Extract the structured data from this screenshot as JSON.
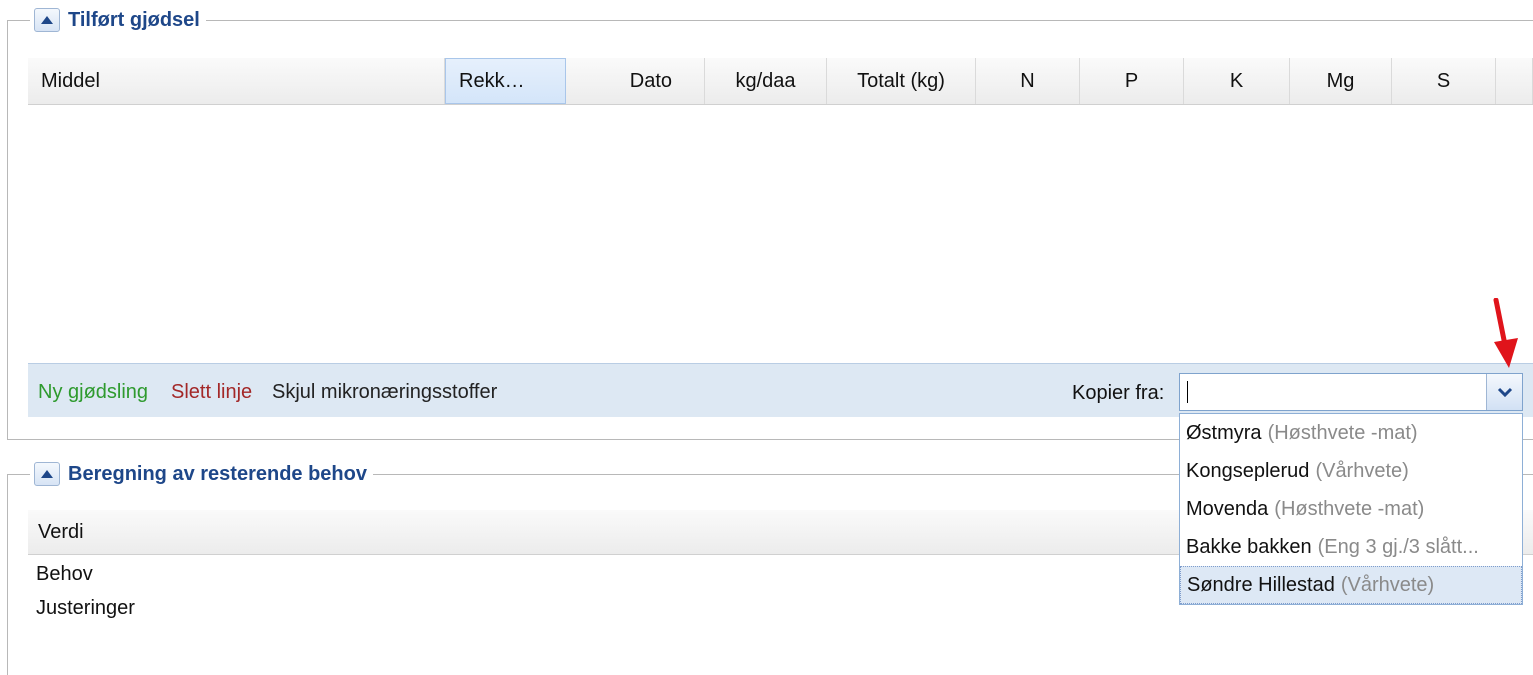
{
  "section1": {
    "title": "Tilført gjødsel",
    "columns": [
      "Middel",
      "Rekk…",
      "Dato",
      "kg/daa",
      "Totalt (kg)",
      "N",
      "P",
      "K",
      "Mg",
      "S"
    ],
    "toolbar": {
      "new_label": "Ny gjødsling",
      "delete_label": "Slett linje",
      "hide_label": "Skjul mikronæringsstoffer",
      "copy_from_label": "Kopier fra:",
      "copy_from_value": ""
    },
    "dropdown_options": [
      {
        "name": "Østmyra",
        "sub": "(Høsthvete -mat)"
      },
      {
        "name": "Kongseplerud",
        "sub": "(Vårhvete)"
      },
      {
        "name": "Movenda",
        "sub": "(Høsthvete -mat)"
      },
      {
        "name": "Bakke bakken",
        "sub": "(Eng 3 gj./3 slått..."
      },
      {
        "name": "Søndre Hillestad",
        "sub": "(Vårhvete)"
      }
    ]
  },
  "section2": {
    "title": "Beregning av resterende behov",
    "column": "Verdi",
    "rows": [
      "Behov",
      "Justeringer"
    ]
  },
  "colors": {
    "accent": "#1e4789",
    "new_link": "#2e9a2e",
    "delete_link": "#a32828",
    "annotation_arrow": "#e0141b"
  }
}
